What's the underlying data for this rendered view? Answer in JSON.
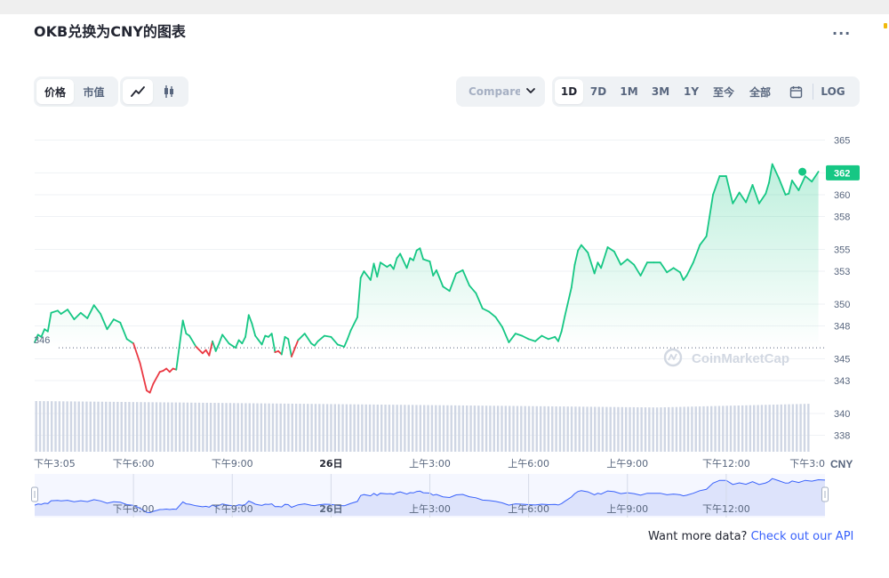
{
  "title": "OKB兑换为CNY的图表",
  "toolbar": {
    "metric_tabs": [
      {
        "label": "价格",
        "active": true
      },
      {
        "label": "市值",
        "active": false
      }
    ],
    "chart_type_tabs": [
      {
        "icon": "line-chart-icon",
        "active": true
      },
      {
        "icon": "candlestick-icon",
        "active": false
      }
    ],
    "compare_label": "Compare with",
    "range_tabs": [
      {
        "label": "1D",
        "active": true
      },
      {
        "label": "7D",
        "active": false
      },
      {
        "label": "1M",
        "active": false
      },
      {
        "label": "3M",
        "active": false
      },
      {
        "label": "1Y",
        "active": false
      },
      {
        "label": "至今",
        "active": false
      },
      {
        "label": "全部",
        "active": false
      }
    ],
    "calendar_icon": "calendar-icon",
    "log_label": "LOG",
    "more_label": "..."
  },
  "colors": {
    "up": "#16c784",
    "down": "#ea3943",
    "grid": "#eff2f5",
    "volume": "#cfd6e4",
    "axis_text": "#58667e",
    "nav_fill": "#dde3fb",
    "nav_line": "#3861fb"
  },
  "chart_data": {
    "type": "line",
    "currency_label": "CNY",
    "y_ticks": [
      365,
      362,
      360,
      358,
      355,
      353,
      350,
      348,
      345,
      343,
      340,
      338
    ],
    "ylim": [
      336.5,
      366.5
    ],
    "x_ticks": [
      "下午3:05",
      "下午6:00",
      "下午9:00",
      "26日",
      "上午3:00",
      "上午6:00",
      "上午9:00",
      "下午12:00",
      "下午3:0"
    ],
    "x_tick_hours": [
      0,
      3,
      6,
      9,
      12,
      15,
      18,
      21,
      23.8
    ],
    "baseline": 346,
    "baseline_label": "346",
    "current_value": 362,
    "current_label": "362",
    "watermark": "CoinMarketCap",
    "series": [
      {
        "hours": [
          0,
          0.1,
          0.2,
          0.3,
          0.4,
          0.5,
          0.7,
          0.8,
          1.0,
          1.2,
          1.4,
          1.6,
          1.8,
          2.0,
          2.2,
          2.4,
          2.6,
          2.8,
          3.0,
          3.2,
          3.4,
          3.5,
          3.6,
          3.8,
          3.9,
          4.0,
          4.1,
          4.2,
          4.3,
          4.5,
          4.6,
          4.7,
          4.9,
          5.1,
          5.2,
          5.3,
          5.4,
          5.5,
          5.6,
          5.7,
          5.9,
          6.0,
          6.1,
          6.2,
          6.3,
          6.4,
          6.5,
          6.6,
          6.7,
          6.8,
          6.9,
          7.0,
          7.1,
          7.2,
          7.3,
          7.4,
          7.5,
          7.6,
          7.7,
          7.8,
          8.0,
          8.2,
          8.4,
          8.5,
          8.6,
          8.8,
          9.0,
          9.2,
          9.4,
          9.5,
          9.6,
          9.8,
          9.9,
          10.0,
          10.2,
          10.3,
          10.4,
          10.5,
          10.7,
          10.8,
          10.9,
          11.0,
          11.1,
          11.3,
          11.4,
          11.5,
          11.6,
          11.7,
          11.8,
          12.0,
          12.1,
          12.2,
          12.4,
          12.6,
          12.8,
          13.0,
          13.2,
          13.4,
          13.6,
          13.8,
          14.0,
          14.2,
          14.4,
          14.6,
          14.8,
          15.0,
          15.2,
          15.4,
          15.6,
          15.8,
          15.9,
          16.0,
          16.1,
          16.3,
          16.4,
          16.5,
          16.6,
          16.8,
          17.0,
          17.1,
          17.2,
          17.4,
          17.6,
          17.8,
          18.0,
          18.2,
          18.4,
          18.6,
          18.8,
          19.0,
          19.2,
          19.4,
          19.6,
          19.7,
          19.8,
          20.0,
          20.2,
          20.4,
          20.6,
          20.8,
          21.0,
          21.2,
          21.4,
          21.6,
          21.8,
          22.0,
          22.2,
          22.3,
          22.4,
          22.6,
          22.8,
          22.9,
          23.0,
          23.2,
          23.4,
          23.6,
          23.8
        ],
        "values": [
          346.5,
          347.2,
          347,
          347.7,
          347.5,
          349.2,
          349.4,
          349.1,
          349.5,
          348.6,
          349.2,
          348.7,
          349.9,
          349.1,
          347.7,
          348.6,
          348.3,
          346.8,
          346.4,
          344.6,
          342.1,
          341.9,
          342.7,
          343.8,
          343.9,
          344.1,
          343.8,
          344.1,
          344,
          348.5,
          347.3,
          347.1,
          346.1,
          345.5,
          345.8,
          345.3,
          346.6,
          345.7,
          346.4,
          347.2,
          346.4,
          346.2,
          346,
          346.7,
          346.4,
          347,
          349,
          348.2,
          347.1,
          346.7,
          346.3,
          347.1,
          347,
          347.3,
          345.6,
          345.7,
          345.4,
          347,
          346.8,
          345.2,
          346.7,
          347.3,
          346.4,
          346.2,
          346.6,
          347.1,
          347,
          346.3,
          346.1,
          346.8,
          347.6,
          348.8,
          352.4,
          353,
          352.2,
          353.7,
          352.5,
          353.8,
          353.4,
          353.6,
          353.2,
          354.2,
          354.6,
          353.3,
          354.2,
          354,
          354.9,
          355.1,
          354.1,
          353.9,
          352.6,
          353.1,
          351.6,
          351.2,
          352.8,
          353.1,
          351.7,
          351,
          349.6,
          349.3,
          348.8,
          347.9,
          346.5,
          347.3,
          347.1,
          346.8,
          346.6,
          347.1,
          346.8,
          347,
          346.6,
          347.5,
          348.9,
          351.5,
          353.6,
          354.9,
          355.4,
          354.7,
          352.8,
          353.8,
          353.3,
          355.2,
          354.8,
          353.6,
          354.1,
          353.6,
          352.6,
          353.8,
          353.8,
          353.8,
          352.9,
          353.3,
          352.9,
          352.2,
          352.6,
          353.8,
          355.4,
          356.2,
          360,
          361.7,
          361.7,
          359.2,
          360.2,
          359.3,
          360.9,
          359.2,
          360.1,
          361.1,
          362.8,
          361.5,
          360,
          360.1,
          361.3,
          360.4,
          361.7,
          361.2,
          362.1,
          361.9
        ]
      }
    ],
    "navigator_x_labels": [
      "下午6:00",
      "下午9:00",
      "26日",
      "上午3:00",
      "上午6:00",
      "上午9:00",
      "下午12:00"
    ]
  },
  "footer": {
    "text": "Want more data?",
    "link": "Check out our API"
  }
}
